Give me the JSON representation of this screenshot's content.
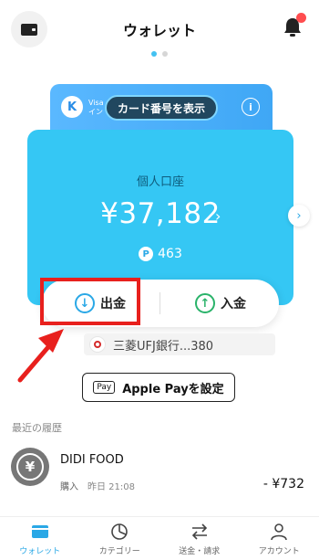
{
  "header": {
    "title": "ウォレット"
  },
  "pager": {
    "count": 2,
    "active": 0
  },
  "card_back": {
    "logo_letter": "K",
    "visa_text_line1": "Visa",
    "visa_text_line2": "イン",
    "show_number_label": "カード番号を表示",
    "info_label": "i"
  },
  "account": {
    "label": "個人口座",
    "balance": "¥37,182",
    "balance_chevron": "›",
    "points_badge": "P",
    "points": "463",
    "next_chevron": "›"
  },
  "actions": {
    "withdraw_label": "出金",
    "withdraw_icon": "↓",
    "deposit_label": "入金",
    "deposit_icon": "↑"
  },
  "bank": {
    "name": "三菱UFJ銀行...380"
  },
  "apple_pay": {
    "badge": "Pay",
    "label": "Apple Payを設定"
  },
  "history": {
    "section_label": "最近の履歴",
    "items": [
      {
        "icon": "¥",
        "name": "DIDI FOOD",
        "type": "購入",
        "time": "昨日 21:08",
        "amount": "- ¥732"
      }
    ]
  },
  "tabs": [
    {
      "label": "ウォレット",
      "active": true
    },
    {
      "label": "カテゴリー",
      "active": false
    },
    {
      "label": "送金・請求",
      "active": false
    },
    {
      "label": "アカウント",
      "active": false
    }
  ],
  "colors": {
    "accent": "#35c7f4",
    "highlight": "#e8201d",
    "deposit": "#2ab36a"
  }
}
